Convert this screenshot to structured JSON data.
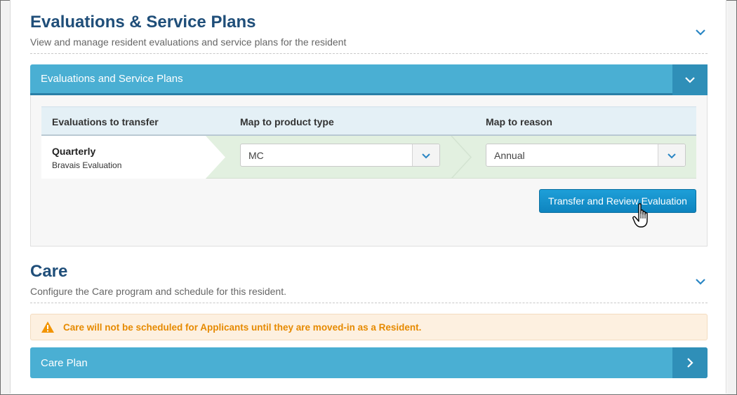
{
  "evaluations_section": {
    "title": "Evaluations & Service Plans",
    "subtitle": "View and manage resident evaluations and service plans for the resident"
  },
  "evaluations_panel": {
    "header": "Evaluations and Service Plans",
    "columns": [
      "Evaluations to transfer",
      "Map to product type",
      "Map to reason"
    ],
    "row": {
      "title": "Quarterly",
      "subtitle": "Bravais Evaluation",
      "product_type": "MC",
      "reason": "Annual"
    },
    "transfer_button": "Transfer and Review Evaluation"
  },
  "care_section": {
    "title": "Care",
    "subtitle": "Configure the Care program and schedule for this resident.",
    "alert": "Care will not be scheduled for Applicants until they are moved-in as a Resident.",
    "care_plan_label": "Care Plan"
  },
  "colors": {
    "title": "#1f4e79",
    "panel_bar": "#4aafd3",
    "panel_bar_button": "#2f8fb8",
    "primary_button": "#1596d0",
    "alert_text": "#e68a00",
    "alert_bg": "#fdf0e0",
    "row_green": "#e2f0e0"
  },
  "icons": {
    "section_toggle": "chevron-down-icon",
    "panel_toggle": "chevron-down-icon",
    "select_caret": "chevron-down-icon",
    "care_plan_arrow": "chevron-right-icon",
    "alert": "warning-triangle-icon",
    "cursor": "hand-pointer-icon"
  }
}
